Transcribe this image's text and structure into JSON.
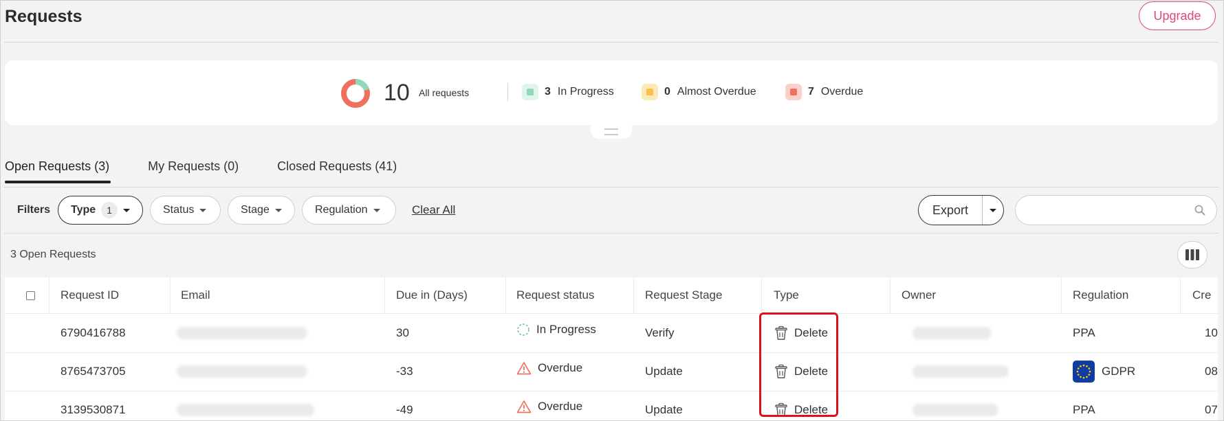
{
  "header": {
    "title": "Requests",
    "upgrade_label": "Upgrade"
  },
  "summary": {
    "total_count": "10",
    "total_label": "All requests",
    "stats": [
      {
        "count": "3",
        "label": "In Progress",
        "color": "#8fd8b8"
      },
      {
        "count": "0",
        "label": "Almost Overdue",
        "color": "#f7c04a"
      },
      {
        "count": "7",
        "label": "Overdue",
        "color": "#f0705e"
      }
    ]
  },
  "tabs": [
    {
      "label": "Open Requests (3)"
    },
    {
      "label": "My Requests (0)"
    },
    {
      "label": "Closed Requests (41)"
    }
  ],
  "filters": {
    "label": "Filters",
    "type": {
      "label": "Type",
      "badge": "1"
    },
    "status": {
      "label": "Status"
    },
    "stage": {
      "label": "Stage"
    },
    "regulation": {
      "label": "Regulation"
    },
    "clear_all": "Clear All",
    "export_label": "Export",
    "search_placeholder": ""
  },
  "results": {
    "count_label": "3 Open Requests"
  },
  "table": {
    "columns": [
      "Request ID",
      "Email",
      "Due in (Days)",
      "Request status",
      "Request Stage",
      "Type",
      "Owner",
      "Regulation",
      "Cre"
    ],
    "rows": [
      {
        "id": "6790416788",
        "due": "30",
        "status": "In Progress",
        "stage": "Verify",
        "type": "Delete",
        "regulation": "PPA",
        "created": "10/"
      },
      {
        "id": "8765473705",
        "due": "-33",
        "status": "Overdue",
        "stage": "Update",
        "type": "Delete",
        "regulation": "GDPR",
        "created": "08/"
      },
      {
        "id": "3139530871",
        "due": "-49",
        "status": "Overdue",
        "stage": "Update",
        "type": "Delete",
        "regulation": "PPA",
        "created": "07/"
      }
    ]
  },
  "colors": {
    "accent": "#e0457b",
    "highlight": "#e0101a",
    "overdue": "#f0705e",
    "progress": "#8fd8b8"
  }
}
